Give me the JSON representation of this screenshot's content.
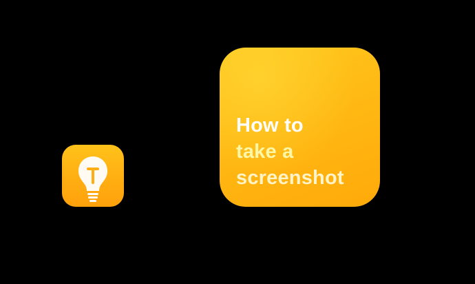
{
  "app_icon": {
    "icon": "lightbulb-icon",
    "colors": {
      "background_top": "#FFC21A",
      "background_bottom": "#FFA10C",
      "bulb": "#FFFFFF"
    }
  },
  "tile": {
    "lines": [
      "How to",
      "take a",
      "screenshot"
    ],
    "colors": {
      "background_top": "#FFC81E",
      "background_bottom": "#FFAA0A",
      "line_1": "#FFFFFF",
      "line_2": "#FFF7A8",
      "line_3": "#FFF3C8"
    }
  }
}
